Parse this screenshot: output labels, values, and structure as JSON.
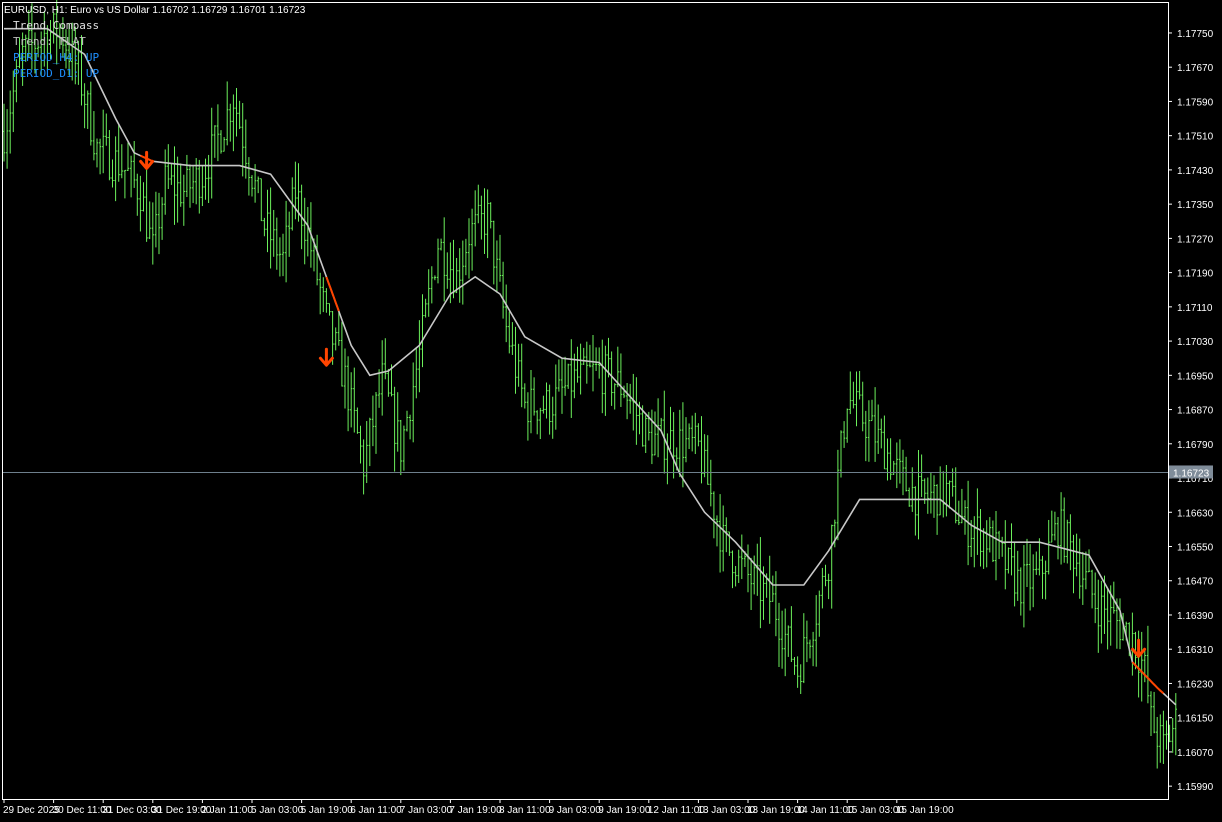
{
  "header": {
    "symbol_line": "EURUSD, H1:  Euro vs US Dollar  1.16702 1.16729 1.16701 1.16723"
  },
  "indicator": {
    "title": "Trend Compass",
    "trend": "Trend: FLAT",
    "period_1": "PERIOD_H4: UP",
    "period_2": "PERIOD_D1: UP",
    "colors": {
      "title": "#e0e0e0",
      "trend": "#bdbdbd",
      "period": "#1e90ff"
    }
  },
  "colors": {
    "background": "#000000",
    "candle": "#6cf05c",
    "ma_line": "#c8c8c8",
    "ma_down": "#ff4500",
    "arrow": "#ff4500",
    "bid_line": "#6e7f8c",
    "price_tag_bg": "#7f8c99",
    "axis": "#ffffff"
  },
  "chart_data": {
    "type": "candlestick",
    "symbol": "EURUSD",
    "timeframe": "H1",
    "current_price": 1.16723,
    "current_price_label": "1.16723",
    "ylim": [
      1.1596,
      1.1782
    ],
    "y_ticks": [
      "1.17750",
      "1.17670",
      "1.17590",
      "1.17510",
      "1.17430",
      "1.17350",
      "1.17270",
      "1.17190",
      "1.17110",
      "1.17030",
      "1.16950",
      "1.16870",
      "1.16790",
      "1.16710",
      "1.16630",
      "1.16550",
      "1.16470",
      "1.16390",
      "1.16310",
      "1.16230",
      "1.16150",
      "1.16070",
      "1.15990"
    ],
    "x_ticks": [
      "29 Dec 2025",
      "30 Dec 11:00",
      "31 Dec 03:00",
      "31 Dec 19:00",
      "2 Jan 11:00",
      "5 Jan 03:00",
      "5 Jan 19:00",
      "6 Jan 11:00",
      "7 Jan 03:00",
      "7 Jan 19:00",
      "8 Jan 11:00",
      "9 Jan 03:00",
      "9 Jan 19:00",
      "12 Jan 11:00",
      "13 Jan 03:00",
      "13 Jan 19:00",
      "14 Jan 11:00",
      "15 Jan 03:00",
      "15 Jan 19:00"
    ],
    "bars_per_tick": 16,
    "close_path": [
      [
        0,
        1.1752
      ],
      [
        6,
        1.177
      ],
      [
        12,
        1.1774
      ],
      [
        18,
        1.1776
      ],
      [
        24,
        1.1766
      ],
      [
        30,
        1.1748
      ],
      [
        38,
        1.1744
      ],
      [
        44,
        1.1738
      ],
      [
        48,
        1.1724
      ],
      [
        52,
        1.174
      ],
      [
        58,
        1.1738
      ],
      [
        64,
        1.1742
      ],
      [
        70,
        1.1752
      ],
      [
        74,
        1.176
      ],
      [
        78,
        1.1748
      ],
      [
        84,
        1.173
      ],
      [
        90,
        1.1722
      ],
      [
        94,
        1.1738
      ],
      [
        98,
        1.1728
      ],
      [
        104,
        1.1708
      ],
      [
        110,
        1.1694
      ],
      [
        116,
        1.1674
      ],
      [
        122,
        1.1694
      ],
      [
        128,
        1.1678
      ],
      [
        134,
        1.17
      ],
      [
        140,
        1.1726
      ],
      [
        146,
        1.1718
      ],
      [
        150,
        1.1728
      ],
      [
        156,
        1.1732
      ],
      [
        162,
        1.1706
      ],
      [
        168,
        1.1688
      ],
      [
        176,
        1.1688
      ],
      [
        184,
        1.1694
      ],
      [
        192,
        1.1696
      ],
      [
        200,
        1.1692
      ],
      [
        208,
        1.168
      ],
      [
        216,
        1.168
      ],
      [
        224,
        1.1678
      ],
      [
        232,
        1.1656
      ],
      [
        240,
        1.1648
      ],
      [
        248,
        1.1642
      ],
      [
        256,
        1.1626
      ],
      [
        262,
        1.164
      ],
      [
        266,
        1.1652
      ],
      [
        272,
        1.169
      ],
      [
        278,
        1.1684
      ],
      [
        284,
        1.1678
      ],
      [
        290,
        1.167
      ],
      [
        296,
        1.1666
      ],
      [
        304,
        1.1668
      ],
      [
        310,
        1.166
      ],
      [
        316,
        1.1658
      ],
      [
        322,
        1.1652
      ],
      [
        328,
        1.1646
      ],
      [
        334,
        1.1648
      ],
      [
        340,
        1.166
      ],
      [
        346,
        1.1652
      ],
      [
        352,
        1.1642
      ],
      [
        358,
        1.1638
      ],
      [
        364,
        1.1634
      ],
      [
        368,
        1.1626
      ],
      [
        370,
        1.1614
      ],
      [
        374,
        1.1608
      ],
      [
        378,
        1.1614
      ]
    ],
    "ma_path": [
      [
        0,
        1.1776
      ],
      [
        14,
        1.1776
      ],
      [
        26,
        1.177
      ],
      [
        36,
        1.1755
      ],
      [
        42,
        1.1747
      ],
      [
        48,
        1.1745
      ],
      [
        60,
        1.1744
      ],
      [
        76,
        1.1744
      ],
      [
        86,
        1.1742
      ],
      [
        98,
        1.173
      ],
      [
        106,
        1.1714
      ],
      [
        112,
        1.1702
      ],
      [
        118,
        1.1695
      ],
      [
        124,
        1.1696
      ],
      [
        134,
        1.1702
      ],
      [
        144,
        1.1714
      ],
      [
        152,
        1.1718
      ],
      [
        160,
        1.1714
      ],
      [
        168,
        1.1704
      ],
      [
        180,
        1.1699
      ],
      [
        192,
        1.1698
      ],
      [
        202,
        1.169
      ],
      [
        212,
        1.1682
      ],
      [
        218,
        1.1672
      ],
      [
        226,
        1.1663
      ],
      [
        236,
        1.1656
      ],
      [
        248,
        1.1646
      ],
      [
        258,
        1.1646
      ],
      [
        266,
        1.1654
      ],
      [
        276,
        1.1666
      ],
      [
        290,
        1.1666
      ],
      [
        302,
        1.1666
      ],
      [
        312,
        1.166
      ],
      [
        322,
        1.1656
      ],
      [
        334,
        1.1656
      ],
      [
        350,
        1.1653
      ],
      [
        360,
        1.164
      ],
      [
        364,
        1.1628
      ],
      [
        372,
        1.1622
      ],
      [
        378,
        1.1618
      ]
    ],
    "ma_down_segments": [
      [
        44,
        48
      ],
      [
        104,
        108
      ],
      [
        364,
        374
      ]
    ],
    "arrows": [
      {
        "bar": 46,
        "price": 1.1745
      },
      {
        "bar": 104,
        "price": 1.1699
      },
      {
        "bar": 366,
        "price": 1.1631
      }
    ]
  }
}
